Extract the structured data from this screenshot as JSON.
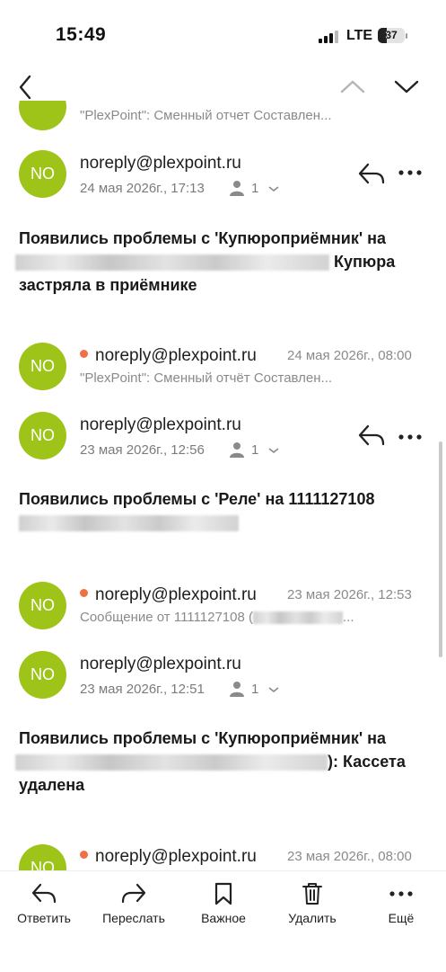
{
  "status_bar": {
    "time": "15:49",
    "network": "LTE",
    "battery": "37"
  },
  "messages": [
    {
      "snippet": "\"PlexPoint\": Сменный отчет Составлен..."
    },
    {
      "avatar": "NO",
      "sender": "noreply@plexpoint.ru",
      "date": "24 мая 2026г., 17:13",
      "recipients": "1",
      "body_prefix": "Появились проблемы с 'Купюроприёмник' на",
      "body_suffix": "Купюра застряла в приёмнике"
    },
    {
      "avatar": "NO",
      "sender": "noreply@plexpoint.ru",
      "date": "24 мая 2026г., 08:00",
      "snippet": "\"PlexPoint\": Сменный отчёт Составлен..."
    },
    {
      "avatar": "NO",
      "sender": "noreply@plexpoint.ru",
      "date": "23 мая 2026г., 12:56",
      "recipients": "1",
      "body_prefix": "Появились проблемы с 'Реле' на 1111127108"
    },
    {
      "avatar": "NO",
      "sender": "noreply@plexpoint.ru",
      "date": "23 мая 2026г., 12:53",
      "snippet": "Сообщение от 1111127108 (",
      "snippet_tail": "..."
    },
    {
      "avatar": "NO",
      "sender": "noreply@plexpoint.ru",
      "date": "23 мая 2026г., 12:51",
      "recipients": "1",
      "body_prefix": "Появились проблемы с 'Купюроприёмник' на",
      "body_suffix": "): Кассета удалена"
    },
    {
      "avatar": "NO",
      "sender": "noreply@plexpoint.ru",
      "date": "23 мая 2026г., 08:00"
    }
  ],
  "toolbar": {
    "reply": "Ответить",
    "forward": "Переслать",
    "important": "Важное",
    "delete": "Удалить",
    "more": "Ещё"
  }
}
